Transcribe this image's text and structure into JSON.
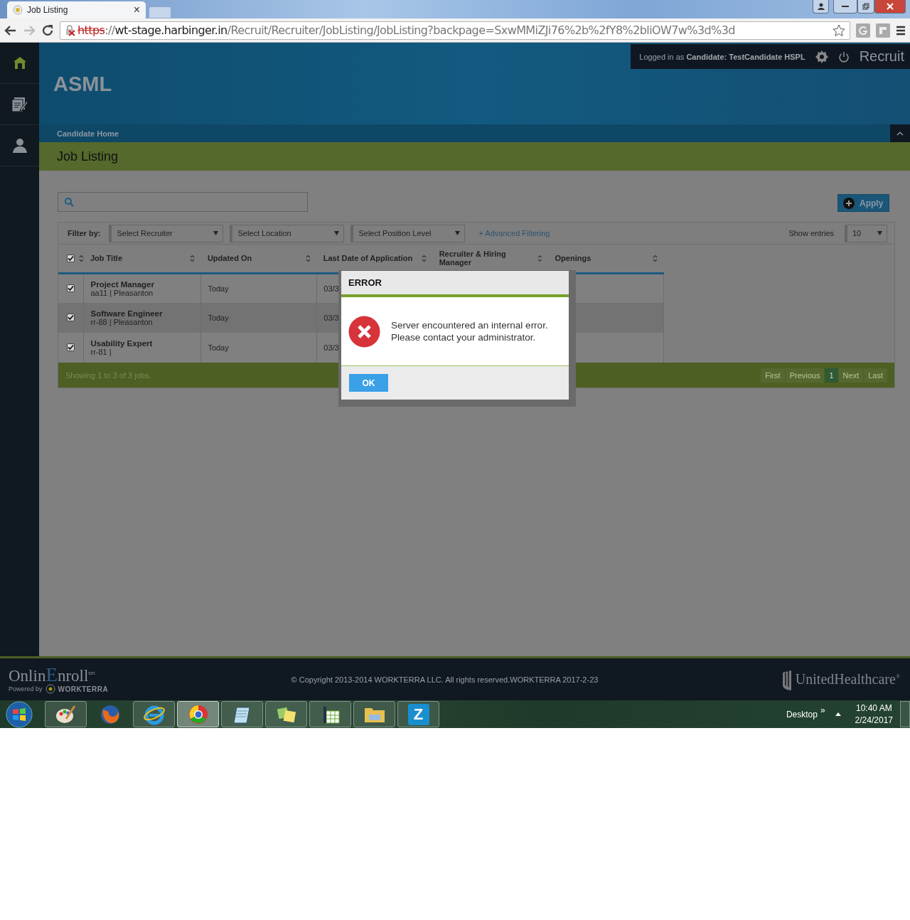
{
  "browser": {
    "tab": {
      "title": "Job Listing",
      "close": "×"
    },
    "url": {
      "insecure": true,
      "scheme": "https",
      "separator": "://",
      "host": "wt-stage.harbinger.in",
      "path": "/Recruit/Recruiter/JobListing/JobListing?backpage=SxwMMiZJi76%2b%2fY8%2bliOW7w%3d%3d"
    }
  },
  "sidebar": {
    "items": [
      {
        "kind": "home",
        "selected": true
      },
      {
        "kind": "notes",
        "selected": false
      },
      {
        "kind": "person",
        "selected": false
      }
    ]
  },
  "header": {
    "brand": "ASML",
    "login": "Logged in as **Candidate:  TestCandidate HSPL**",
    "app_name": "Recruit"
  },
  "breadcrumb": "Candidate Home",
  "page_title": "Job Listing",
  "apply_button": "Apply",
  "filters": {
    "label": "Filter by:",
    "selects": [
      "Select Recruiter",
      "Select Location",
      "Select Position Level"
    ],
    "advanced_link": "+ Advanced Filtering",
    "entries_label": "Show entries",
    "entries_value": "10"
  },
  "table": {
    "select_all_checked": true,
    "columns": [
      "Job Title",
      "Updated On",
      "Last Date of Application",
      "Recruiter & Hiring Manager",
      "Openings"
    ],
    "rows": [
      {
        "checked": true,
        "title": "Project Manager",
        "subtitle": "aa11 | Pleasanton",
        "updated": "Today",
        "last_date": "03/3"
      },
      {
        "checked": true,
        "title": "Software Engineer",
        "subtitle": "rr-88 | Pleasanton",
        "updated": "Today",
        "last_date": "03/3"
      },
      {
        "checked": true,
        "title": "Usability Expert",
        "subtitle": "rr-81 |",
        "updated": "Today",
        "last_date": "03/3"
      }
    ],
    "summary": "Showing 1 to 3 of 3 jobs.",
    "pager": [
      {
        "label": "First",
        "selected": false
      },
      {
        "label": "Previous",
        "selected": false
      },
      {
        "label": "1",
        "selected": true
      },
      {
        "label": "Next",
        "selected": false
      },
      {
        "label": "Last",
        "selected": false
      }
    ]
  },
  "dialog": {
    "title": "ERROR",
    "message": "Server encountered an internal error.\nPlease contact your administrator.",
    "button": "OK"
  },
  "footer": {
    "logo": {
      "prefix": "Onlin",
      "highlight": "E",
      "suffix": "nroll",
      "mark": "sm",
      "powered_by": "Powered by",
      "partner": "WORKTERRA"
    },
    "copyright": "© Copyright 2013-2014 WORKTERRA LLC. All rights reserved.WORKTERRA 2017-2-23",
    "sponsor": "UnitedHealthcare$^{®}$"
  },
  "taskbar": {
    "apps": [
      {
        "kind": "paint",
        "open": true,
        "selected": false
      },
      {
        "kind": "firefox",
        "open": false,
        "selected": false
      },
      {
        "kind": "ie",
        "open": true,
        "selected": false
      },
      {
        "kind": "chrome",
        "open": true,
        "selected": true
      },
      {
        "kind": "notepad",
        "open": true,
        "selected": false
      },
      {
        "kind": "sticky",
        "open": true,
        "selected": false
      },
      {
        "kind": "spreadsheet",
        "open": true,
        "selected": false
      },
      {
        "kind": "folder",
        "open": true,
        "selected": false
      },
      {
        "kind": "letter",
        "open": true,
        "selected": false,
        "label": "Z"
      }
    ],
    "desktop": "Desktop",
    "chevron": "»",
    "clock": {
      "time": "10:40 AM",
      "date": "2/24/2017"
    }
  }
}
